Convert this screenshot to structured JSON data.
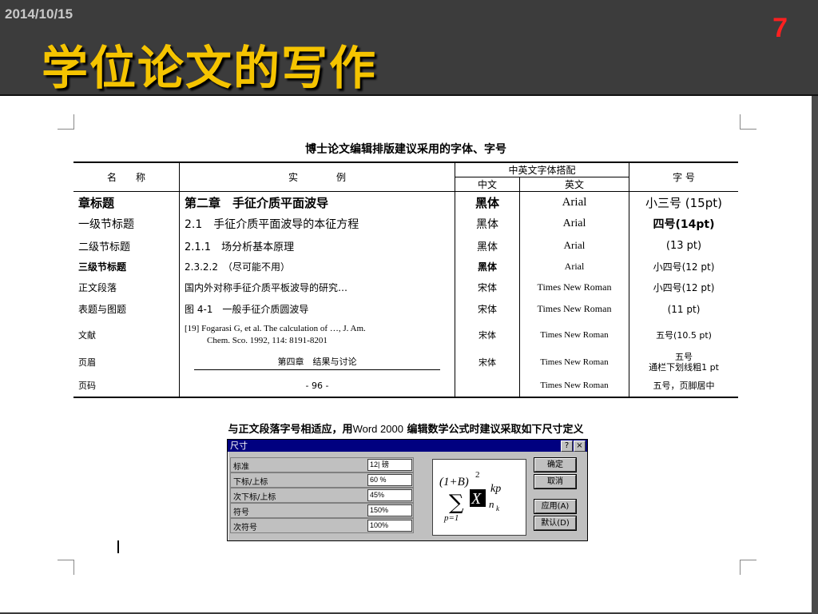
{
  "slide": {
    "date": "2014/10/15",
    "title": "学位论文的写作",
    "page_number": "7"
  },
  "table": {
    "caption": "博士论文编辑排版建议采用的字体、字号",
    "headers": {
      "name": "名　　称",
      "example": "实　　　　例",
      "font_pair": "中英文字体搭配",
      "chinese": "中文",
      "english": "英文",
      "size": "字 号"
    },
    "rows": [
      {
        "name": "章标题",
        "example": "第二章　手征介质平面波导",
        "zh": "黑体",
        "en": "Arial",
        "size": "小三号 (15pt)"
      },
      {
        "name": "一级节标题",
        "example": "2.1　手征介质平面波导的本征方程",
        "zh": "黑体",
        "en": "Arial",
        "size": "四号(14pt)"
      },
      {
        "name": "二级节标题",
        "example": "2.1.1　场分析基本原理",
        "zh": "黑体",
        "en": "Arial",
        "size": "(13 pt)"
      },
      {
        "name": "三级节标题",
        "example": "2.3.2.2　（尽可能不用）",
        "zh": "黑体",
        "en": "Arial",
        "size": "小四号(12 pt)"
      },
      {
        "name": "正文段落",
        "example": "国内外对称手征介质平板波导的研究…",
        "zh": "宋体",
        "en": "Times New Roman",
        "size": "小四号(12 pt)"
      },
      {
        "name": "表题与图题",
        "example": "图 4-1　一般手征介质圆波导",
        "zh": "宋体",
        "en": "Times New Roman",
        "size": "(11 pt)"
      },
      {
        "name": "文献",
        "example_line1": "[19] Fogarasi G, et al. The calculation of …, J. Am.",
        "example_line2": "Chem. Sco. 1992, 114: 8191-8201",
        "zh": "宋体",
        "en": "Times New Roman",
        "size": "五号(10.5 pt)"
      },
      {
        "name": "页眉",
        "example": "第四章　结果与讨论",
        "zh": "宋体",
        "en": "Times New Roman",
        "size_line1": "五号",
        "size_line2": "通栏下划线粗1 pt"
      },
      {
        "name": "页码",
        "example": "- 96 -",
        "zh": "",
        "en": "Times New Roman",
        "size": "五号，页脚居中"
      }
    ]
  },
  "note": {
    "part1": "与正文段落字号相适应，用",
    "part2": "Word 2000",
    "part3": " 编辑数学公式时建议采取如下尺寸定义"
  },
  "dialog": {
    "title": "尺寸",
    "help": "?",
    "close": "×",
    "fields": [
      {
        "label": "标准",
        "value": "12| 磅"
      },
      {
        "label": "下标/上标",
        "value": "60 %"
      },
      {
        "label": "次下标/上标",
        "value": "45%"
      },
      {
        "label": "符号",
        "value": "150%"
      },
      {
        "label": "次符号",
        "value": "100%"
      }
    ],
    "buttons": {
      "ok": "确定",
      "cancel": "取消",
      "apply": "应用(A)",
      "default": "默认(D)"
    },
    "preview": {
      "base": "(1+B)",
      "exp": "2",
      "sum": "∑",
      "lower": "p=1",
      "var": "X",
      "sup": "kp",
      "sub": "n",
      "subsub": "k"
    }
  }
}
